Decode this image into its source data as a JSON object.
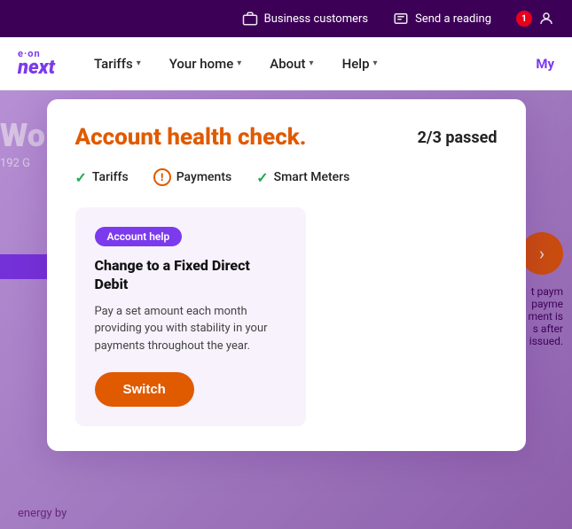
{
  "topbar": {
    "business_customers_label": "Business customers",
    "send_reading_label": "Send a reading",
    "notification_count": "1"
  },
  "nav": {
    "logo_eon": "e·on",
    "logo_next": "next",
    "tariffs_label": "Tariffs",
    "your_home_label": "Your home",
    "about_label": "About",
    "help_label": "Help",
    "my_label": "My"
  },
  "background": {
    "hero_text": "Wo",
    "hero_sub": "192 G",
    "right_info_line1": "t paym",
    "right_info_line2": "payme",
    "right_info_line3": "ment is",
    "right_info_line4": "s after",
    "right_info_line5": "issued.",
    "bottom_text": "energy by"
  },
  "modal": {
    "title": "Account health check.",
    "score_label": "2/3 passed",
    "checks": [
      {
        "label": "Tariffs",
        "status": "pass"
      },
      {
        "label": "Payments",
        "status": "warning"
      },
      {
        "label": "Smart Meters",
        "status": "pass"
      }
    ],
    "card": {
      "badge_label": "Account help",
      "title": "Change to a Fixed Direct Debit",
      "description": "Pay a set amount each month providing you with stability in your payments throughout the year.",
      "switch_label": "Switch"
    }
  }
}
